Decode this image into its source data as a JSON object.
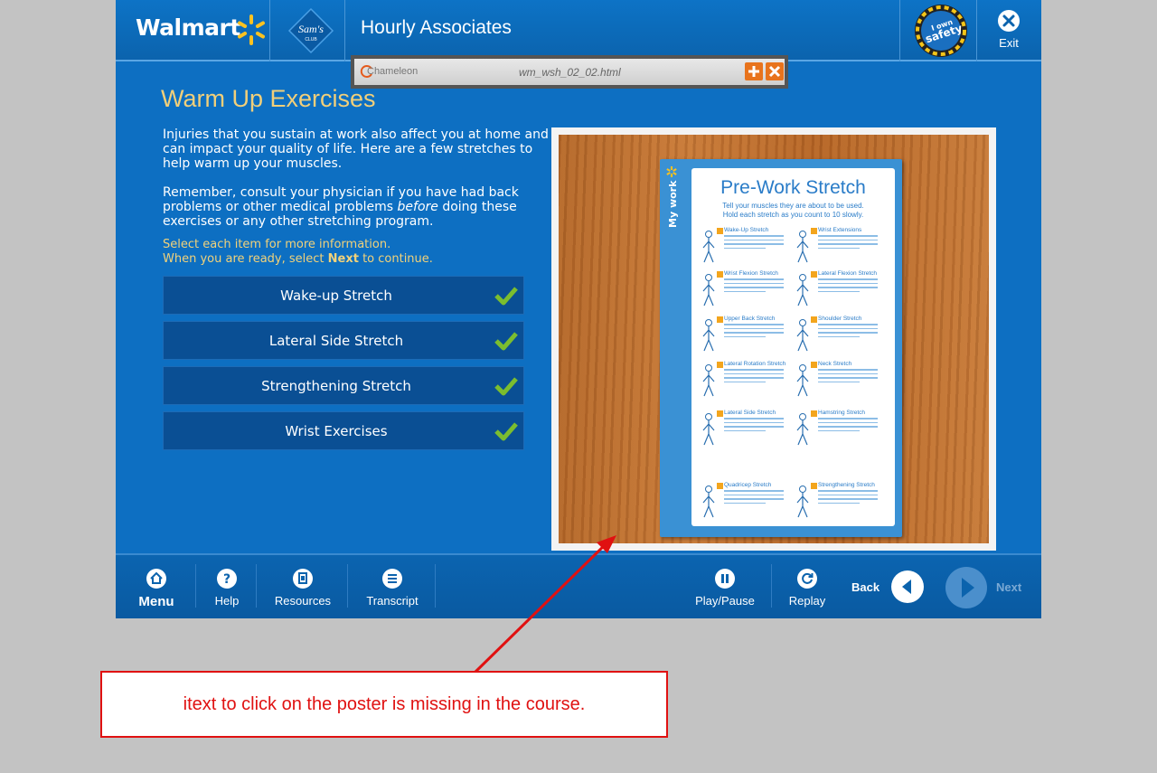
{
  "header": {
    "walmart_logo": "Walmart",
    "sams_logo_line1": "Sam's",
    "sams_logo_line2": "CLUB",
    "title": "Hourly Associates",
    "badge_line1": "I own",
    "badge_line2": "safety",
    "exit_label": "Exit"
  },
  "chameleon": {
    "brand": "Chameleon",
    "filename": "wm_wsh_02_02.html",
    "add_icon": "plus-icon",
    "close_icon": "close-icon"
  },
  "main": {
    "title": "Warm Up Exercises",
    "paragraph1": "Injuries that you sustain at work also affect you at home and can impact your quality of life.  Here are a few stretches to help warm up your muscles.",
    "paragraph2_a": "Remember, consult your physician if you have had back problems or other medical problems ",
    "paragraph2_em": "before",
    "paragraph2_b": " doing these exercises or any other stretching program.",
    "instruction_line1": "Select each item for more information.",
    "instruction_line2_a": "When you are ready, select ",
    "instruction_line2_b": "Next",
    "instruction_line2_c": " to continue.",
    "items": [
      {
        "label": "Wake-up Stretch",
        "completed": true
      },
      {
        "label": "Lateral Side Stretch",
        "completed": true
      },
      {
        "label": "Strengthening Stretch",
        "completed": true
      },
      {
        "label": "Wrist Exercises",
        "completed": true
      }
    ]
  },
  "poster": {
    "side_label": "My work",
    "title": "Pre-Work Stretch",
    "subtitle_line1": "Tell your muscles they are about to be used.",
    "subtitle_line2": "Hold each stretch as you count to 10 slowly.",
    "stretches": [
      "Wake-Up Stretch",
      "Wrist Extensions",
      "Wrist Flexion Stretch",
      "Lateral Flexion Stretch",
      "Upper Back Stretch",
      "Shoulder Stretch",
      "Lateral Rotation Stretch",
      "Neck Stretch",
      "Lateral Side Stretch",
      "Hamstring Stretch",
      "Quadricep Stretch",
      "Strengthening Stretch"
    ]
  },
  "footer": {
    "menu": "Menu",
    "help": "Help",
    "resources": "Resources",
    "transcript": "Transcript",
    "play_pause": "Play/Pause",
    "replay": "Replay",
    "back": "Back",
    "next": "Next",
    "next_enabled": false
  },
  "annotation": {
    "text": "itext to click on the poster is missing in the course.",
    "color": "#e01111"
  },
  "colors": {
    "brand_blue": "#0d6fc2",
    "accent_gold": "#f1cf7a",
    "button_blue": "#0a4f94",
    "check_green": "#7bbd2f"
  }
}
